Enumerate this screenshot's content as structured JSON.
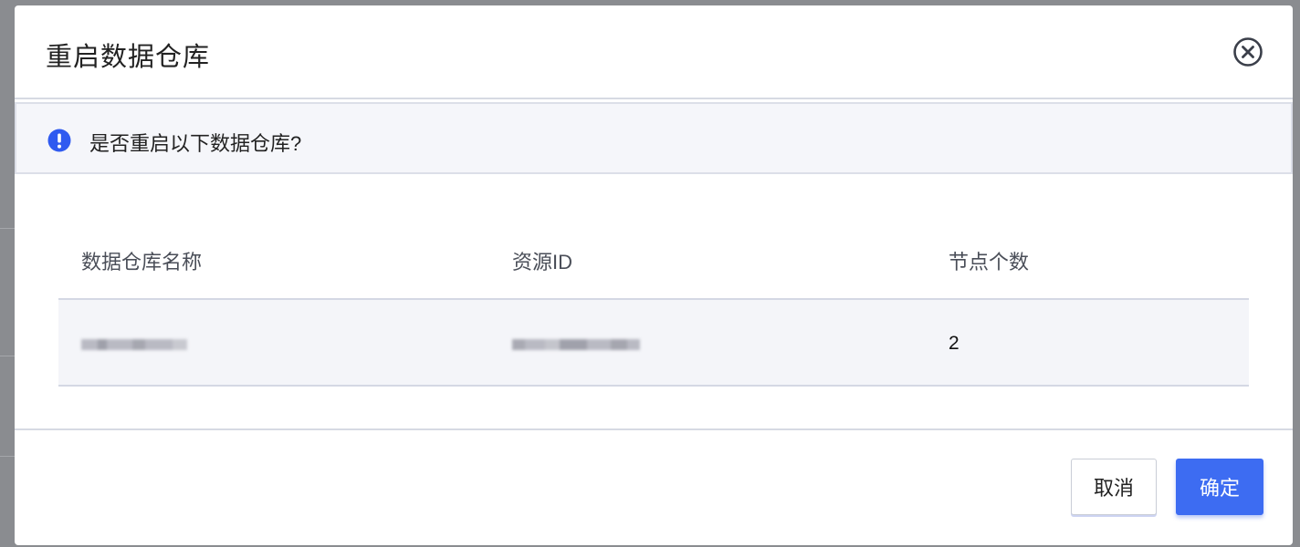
{
  "dialog": {
    "title": "重启数据仓库",
    "close_icon": "close-circle-icon"
  },
  "notice": {
    "icon": "exclamation-circle-icon",
    "icon_color": "#2f5af0",
    "text": "是否重启以下数据仓库?"
  },
  "table": {
    "columns": [
      "数据仓库名称",
      "资源ID",
      "节点个数"
    ],
    "rows": [
      {
        "name": "",
        "resource_id": "",
        "node_count": "2"
      }
    ]
  },
  "footer": {
    "cancel_label": "取消",
    "confirm_label": "确定",
    "accent": "#3d6cf2"
  }
}
